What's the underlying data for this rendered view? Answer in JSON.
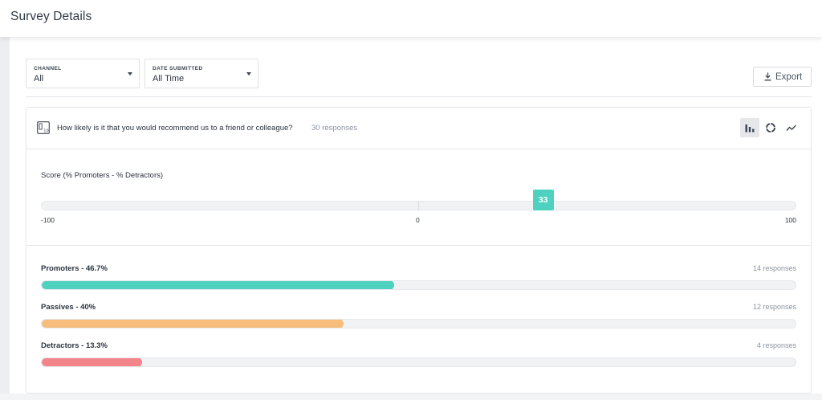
{
  "header": {
    "title": "Survey Details"
  },
  "filters": {
    "channel": {
      "label": "CHANNEL",
      "value": "All"
    },
    "date_submitted": {
      "label": "DATE SUBMITTED",
      "value": "All Time"
    }
  },
  "toolbar": {
    "export_label": "Export",
    "export_icon": "download-icon"
  },
  "question": {
    "icon": "nps-scale-icon",
    "text": "How likely is it that you would recommend us to a friend or colleague?",
    "responses": "30 responses",
    "views": [
      "bar-chart-icon",
      "donut-chart-icon",
      "line-chart-icon"
    ],
    "active_view": "bar-chart-icon"
  },
  "score": {
    "title": "Score (% Promoters - % Detractors)",
    "value": 33,
    "value_label": "33",
    "min": -100,
    "max": 100,
    "ticks": [
      "-100",
      "0",
      "100"
    ]
  },
  "buckets": [
    {
      "label": "Promoters - 46.7%",
      "count": "14 responses",
      "percent": 46.7,
      "color": "#4fd1bf"
    },
    {
      "label": "Passives - 40%",
      "count": "12 responses",
      "percent": 40,
      "color": "#f6bd7d"
    },
    {
      "label": "Detractors - 13.3%",
      "count": "4 responses",
      "percent": 13.3,
      "color": "#f3858a"
    }
  ]
}
